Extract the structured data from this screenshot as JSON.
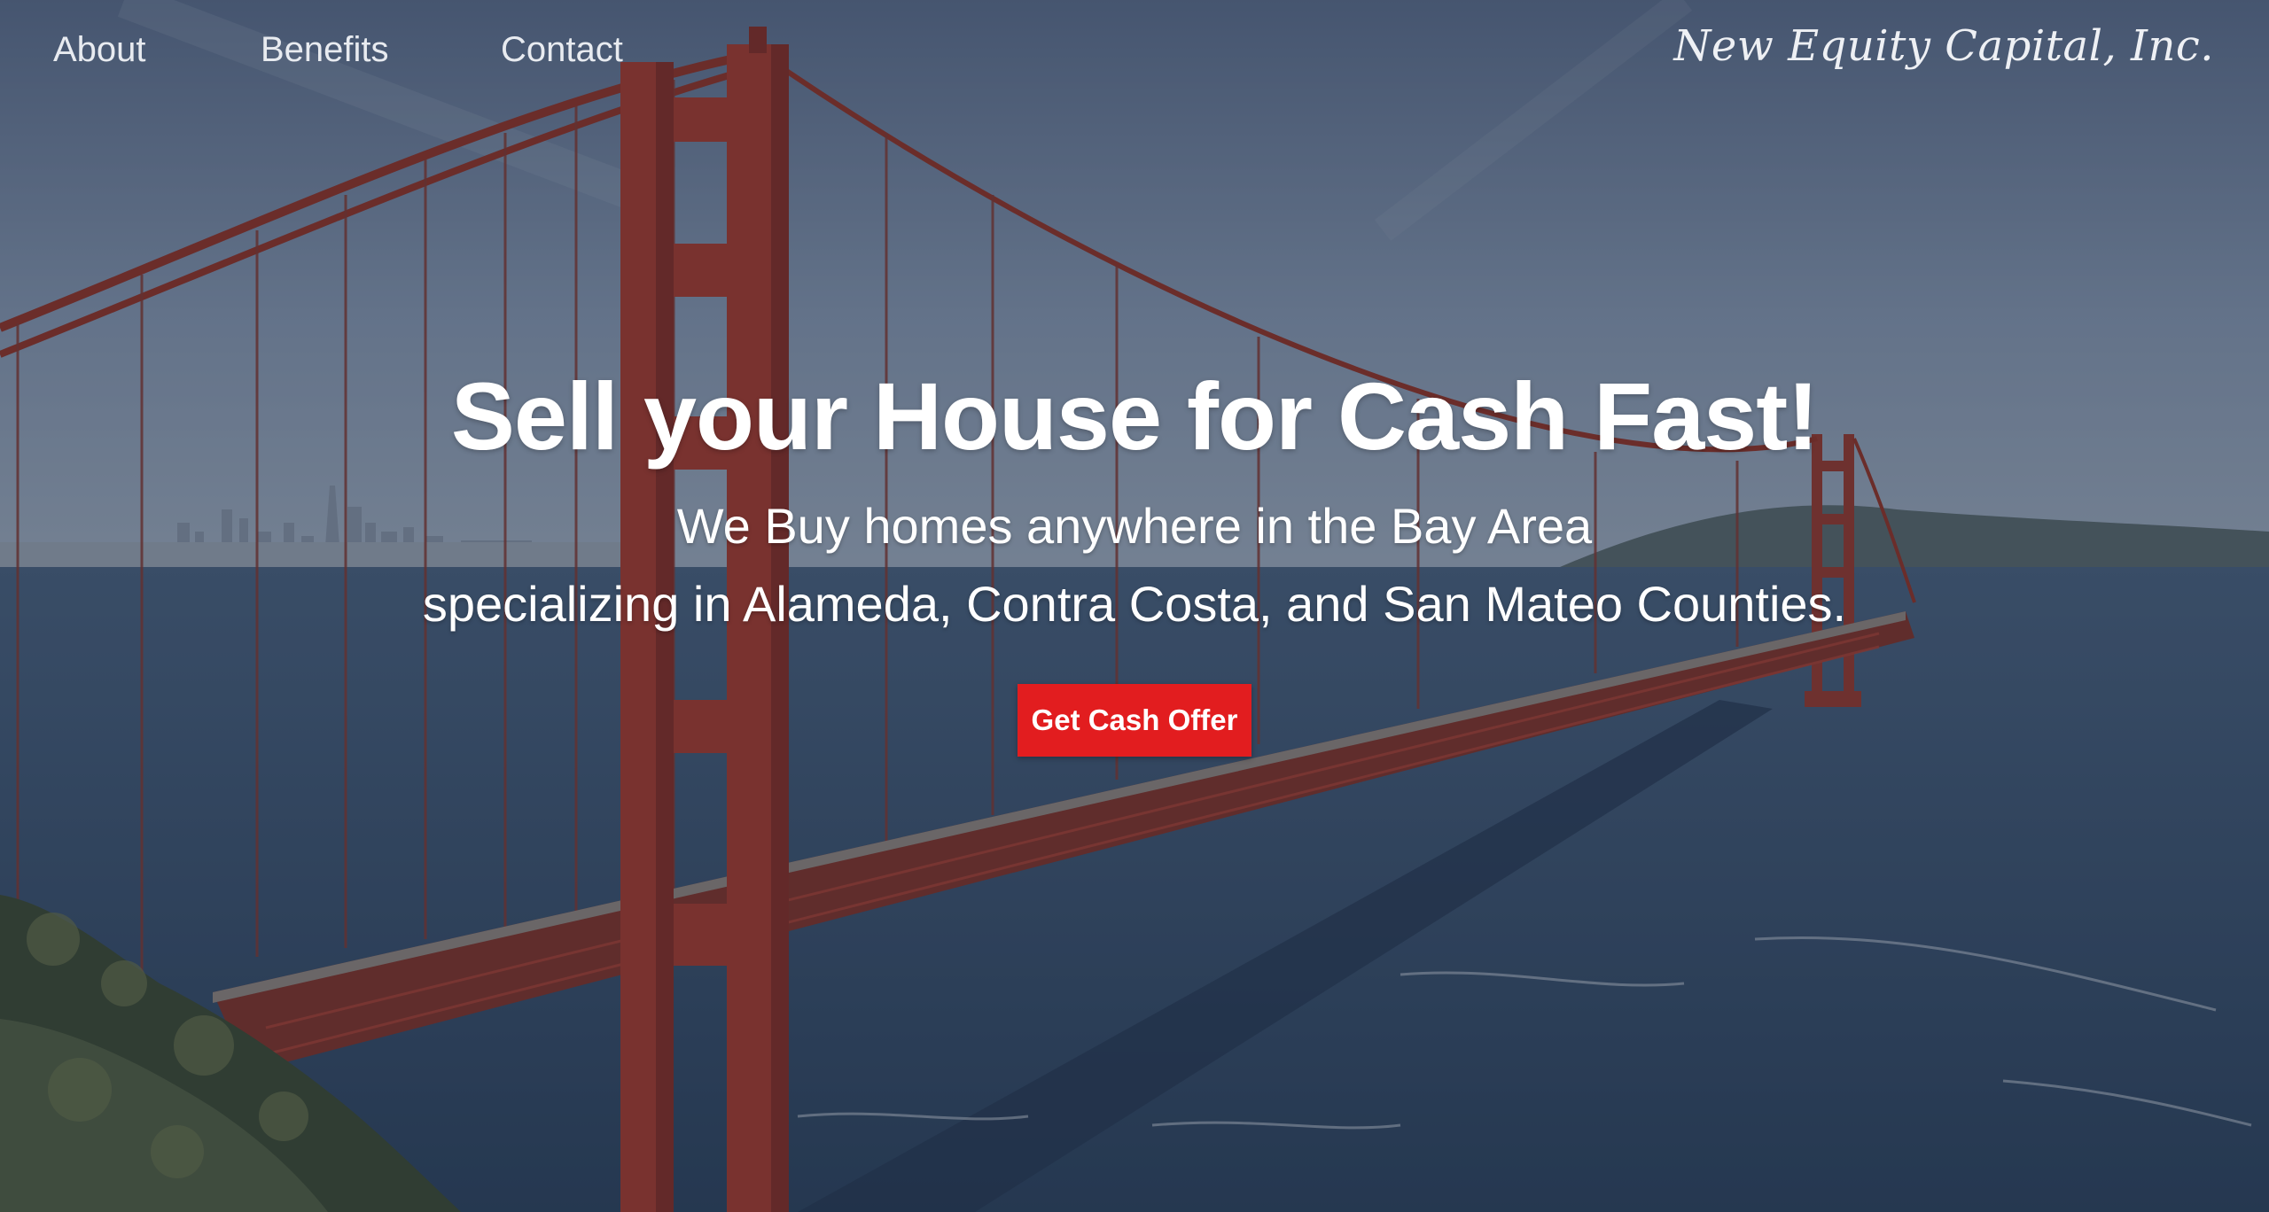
{
  "nav": {
    "items": [
      {
        "label": "About"
      },
      {
        "label": "Benefits"
      },
      {
        "label": "Contact"
      }
    ],
    "brand": "New Equity Capital, Inc."
  },
  "hero": {
    "background_icon": "golden-gate-bridge-photo",
    "headline": "Sell your House for Cash Fast!",
    "subline_1": "We Buy homes anywhere in the Bay Area",
    "subline_2": "specializing in Alameda, Contra Costa, and San Mateo Counties.",
    "cta_label": "Get Cash Offer"
  },
  "colors": {
    "cta": "#e21d1f",
    "bridge": "#b23a2c",
    "water": "#34506e",
    "sky": "#9fb2c9"
  }
}
